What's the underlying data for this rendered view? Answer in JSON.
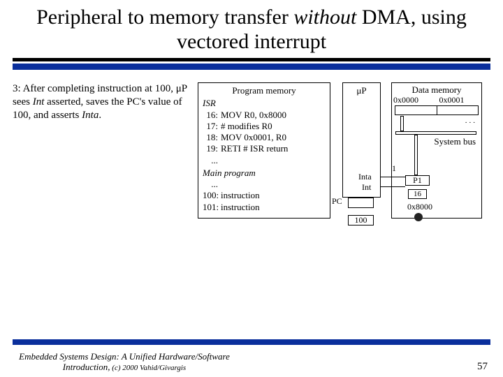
{
  "title_pre": "Peripheral to memory transfer ",
  "title_ital": "without",
  "title_post": " DMA, using vectored interrupt",
  "step_pre": "3: After completing instruction at 100, μP sees ",
  "step_int": "Int",
  "step_mid": " asserted, saves the PC's value of 100, and asserts ",
  "step_inta": "Inta",
  "step_end": ".",
  "pm": {
    "title": "Program memory",
    "isr": "ISR",
    "rows": [
      {
        "n": "16:",
        "c": "MOV R0, 0x8000"
      },
      {
        "n": "17:",
        "c": "# modifies R0"
      },
      {
        "n": "18:",
        "c": "MOV 0x0001, R0"
      },
      {
        "n": "19:",
        "c": "RETI  # ISR return"
      }
    ],
    "dots": "...",
    "main": "Main program",
    "mrows": [
      {
        "n": "100:",
        "c": "instruction"
      },
      {
        "n": "101:",
        "c": "instruction"
      }
    ]
  },
  "up": {
    "title": "μP",
    "pc": "PC",
    "pcval": "100",
    "inta": "Inta",
    "int": "Int",
    "one": "1"
  },
  "dm": {
    "title": "Data memory",
    "a0": "0x0000",
    "a1": "0x0001",
    "dots": "...",
    "sysbus": "System bus",
    "p1": "P1",
    "p1b": "16",
    "p1addr": "0x8000"
  },
  "footer": {
    "book": "Embedded Systems Design: A Unified Hardware/Software Introduction,",
    "copy": " (c) 2000 Vahid/Givargis",
    "page": "57"
  }
}
